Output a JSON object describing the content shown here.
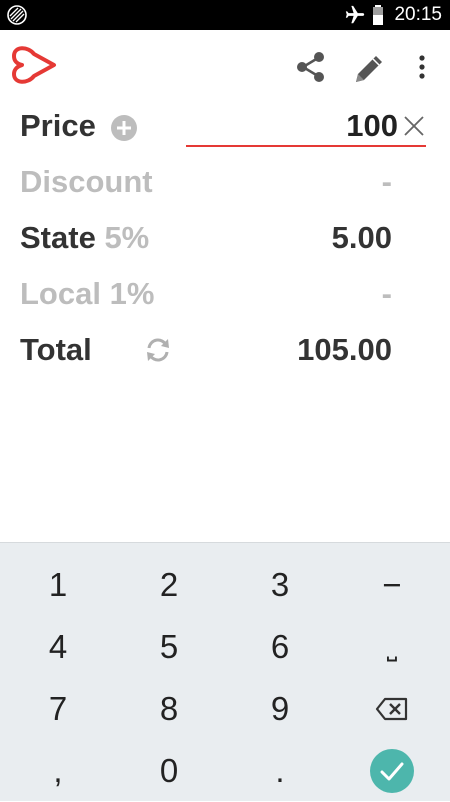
{
  "status_bar": {
    "time": "20:15",
    "icons": [
      "data-sync-icon",
      "airplane-icon",
      "battery-icon"
    ]
  },
  "action_bar": {
    "icons": [
      "app-logo-icon",
      "share-icon",
      "edit-icon",
      "overflow-menu-icon"
    ],
    "logo_color": "#e53935"
  },
  "calculator": {
    "price": {
      "label": "Price",
      "value": "100"
    },
    "discount": {
      "label": "Discount",
      "value": "-"
    },
    "state": {
      "label": "State",
      "rate": "5%",
      "value": "5.00"
    },
    "local": {
      "label": "Local",
      "rate": "1%",
      "value": "-"
    },
    "total": {
      "label": "Total",
      "value": "105.00"
    }
  },
  "keypad": {
    "rows": [
      [
        "1",
        "2",
        "3",
        "−"
      ],
      [
        "4",
        "5",
        "6",
        "⎵"
      ],
      [
        "7",
        "8",
        "9",
        "backspace"
      ],
      [
        ",",
        "0",
        ".",
        "confirm"
      ]
    ]
  },
  "colors": {
    "accent": "#e53935",
    "confirm": "#4db6ac",
    "keypad_bg": "#e9edf0",
    "label_dark": "#333333",
    "label_muted": "#bdbdbd"
  }
}
